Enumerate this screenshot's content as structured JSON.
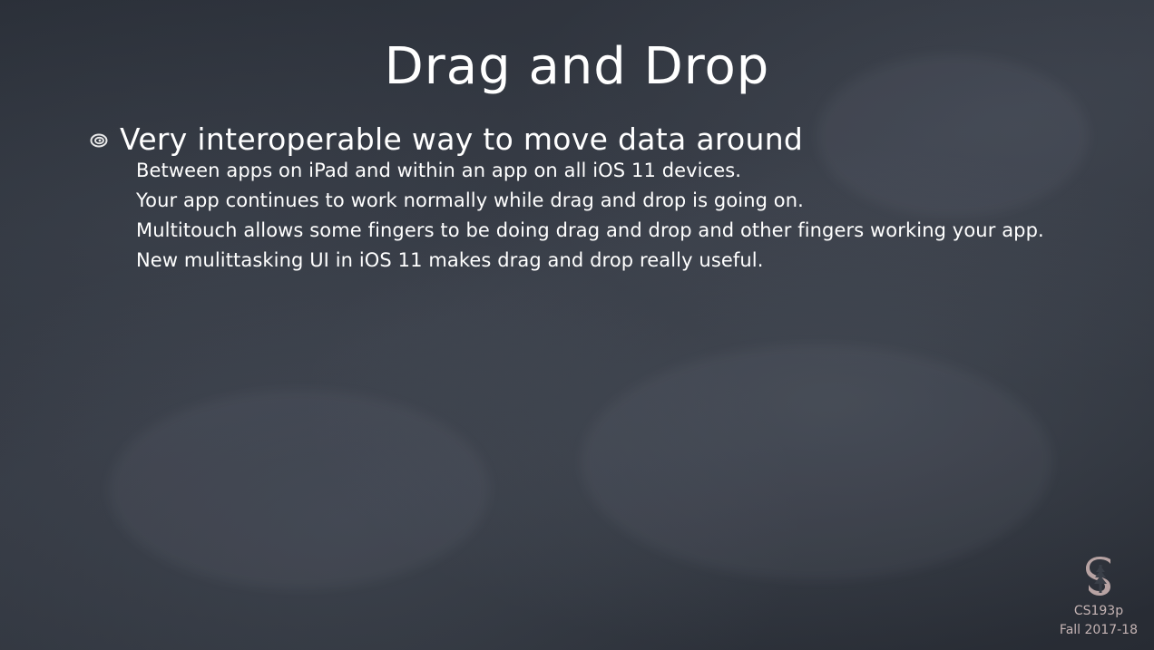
{
  "slide": {
    "title": "Drag and Drop",
    "bullet": {
      "icon": "swirl-bullet-icon",
      "text": "Very interoperable way to move data around"
    },
    "sub_points": [
      "Between apps on iPad and within an app on all iOS 11 devices.",
      "Your app continues to work normally while drag and drop is going on.",
      "Multitouch allows some fingers to be doing drag and drop and other fingers working your app.",
      "New mulittasking UI in iOS 11 makes drag and drop really useful."
    ]
  },
  "footer": {
    "logo_icon": "stanford-s-logo-icon",
    "course": "CS193p",
    "term": "Fall 2017-18"
  },
  "colors": {
    "background": "#2c313a",
    "text": "#ffffff",
    "footer_text": "#c5b4b4",
    "logo": "#b7a3a3"
  }
}
